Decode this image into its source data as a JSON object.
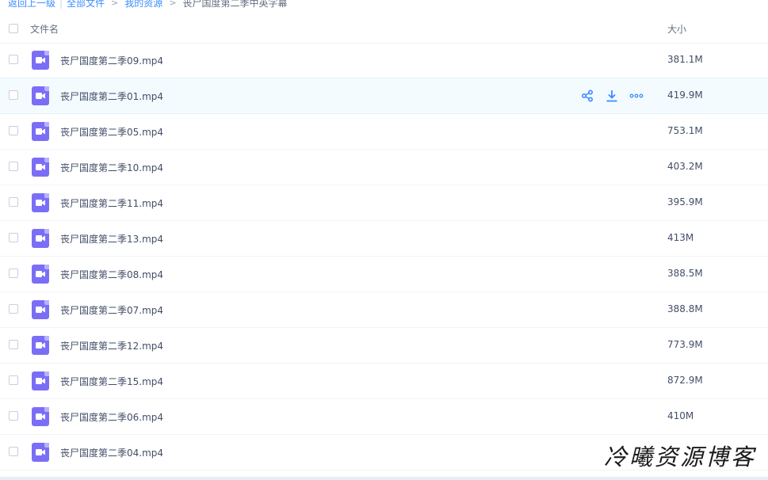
{
  "breadcrumb": {
    "back": "返回上一级",
    "separator": "|",
    "all_files": "全部文件",
    "arrow1": ">",
    "my_resources": "我的资源",
    "arrow2": ">",
    "current": "丧尸国度第二季中英字幕"
  },
  "header": {
    "name_label": "文件名",
    "size_label": "大小"
  },
  "colors": {
    "accent": "#3b8cff",
    "video_icon": "#7b6ef6"
  },
  "files": [
    {
      "name": "丧尸国度第二季09.mp4",
      "size": "381.1M",
      "icon": "video-file-icon"
    },
    {
      "name": "丧尸国度第二季01.mp4",
      "size": "419.9M",
      "icon": "video-file-icon"
    },
    {
      "name": "丧尸国度第二季05.mp4",
      "size": "753.1M",
      "icon": "video-file-icon"
    },
    {
      "name": "丧尸国度第二季10.mp4",
      "size": "403.2M",
      "icon": "video-file-icon"
    },
    {
      "name": "丧尸国度第二季11.mp4",
      "size": "395.9M",
      "icon": "video-file-icon"
    },
    {
      "name": "丧尸国度第二季13.mp4",
      "size": "413M",
      "icon": "video-file-icon"
    },
    {
      "name": "丧尸国度第二季08.mp4",
      "size": "388.5M",
      "icon": "video-file-icon"
    },
    {
      "name": "丧尸国度第二季07.mp4",
      "size": "388.8M",
      "icon": "video-file-icon"
    },
    {
      "name": "丧尸国度第二季12.mp4",
      "size": "773.9M",
      "icon": "video-file-icon"
    },
    {
      "name": "丧尸国度第二季15.mp4",
      "size": "872.9M",
      "icon": "video-file-icon"
    },
    {
      "name": "丧尸国度第二季06.mp4",
      "size": "410M",
      "icon": "video-file-icon"
    },
    {
      "name": "丧尸国度第二季04.mp4",
      "size": "",
      "icon": "video-file-icon"
    }
  ],
  "watermark": "冷曦资源博客"
}
